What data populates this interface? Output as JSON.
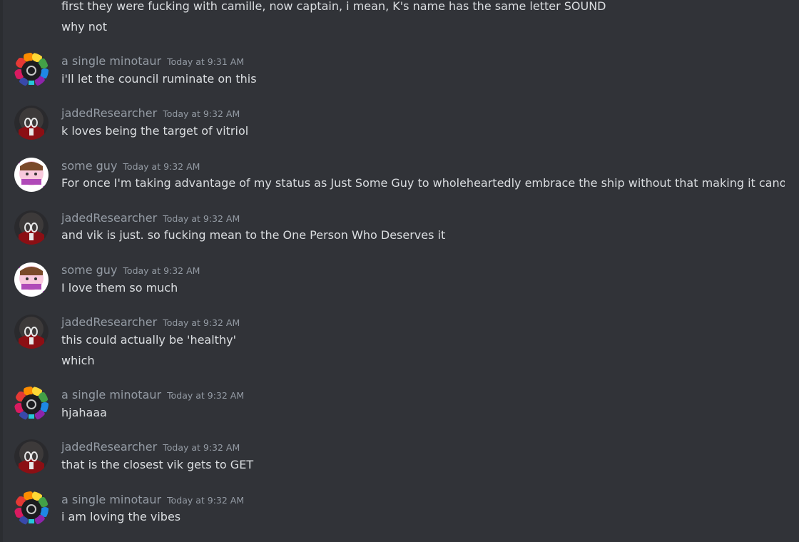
{
  "channel": {
    "messages": [
      {
        "type": "cont",
        "content": "first they were fucking with camille, now captain,  i mean, K's name has the same letter SOUND"
      },
      {
        "type": "cont",
        "content": "why not"
      },
      {
        "type": "group",
        "author": "a single minotaur",
        "avatar": "rainbow-avatar-icon",
        "timestamp": "Today at 9:31 AM",
        "content": "i'll let the council ruminate on this"
      },
      {
        "type": "group",
        "author": "jadedResearcher",
        "avatar": "dark-avatar-icon",
        "timestamp": "Today at 9:32 AM",
        "content": "k loves being the target of vitriol"
      },
      {
        "type": "group",
        "author": "some guy",
        "avatar": "pink-avatar-icon",
        "timestamp": "Today at 9:32 AM",
        "content": "For once I'm taking advantage of my status as Just Some Guy to wholeheartedly embrace the ship without that making it canon"
      },
      {
        "type": "group",
        "author": "jadedResearcher",
        "avatar": "dark-avatar-icon",
        "timestamp": "Today at 9:32 AM",
        "content": "and vik is just. so fucking mean to the One Person Who Deserves it"
      },
      {
        "type": "group",
        "author": "some guy",
        "avatar": "pink-avatar-icon",
        "timestamp": "Today at 9:32 AM",
        "content": "I love them so much"
      },
      {
        "type": "group",
        "author": "jadedResearcher",
        "avatar": "dark-avatar-icon",
        "timestamp": "Today at 9:32 AM",
        "content": "this could actually be 'healthy'"
      },
      {
        "type": "cont",
        "content": "which"
      },
      {
        "type": "group",
        "author": "a single minotaur",
        "avatar": "rainbow-avatar-icon",
        "timestamp": "Today at 9:32 AM",
        "content": "hjahaaa"
      },
      {
        "type": "group",
        "author": "jadedResearcher",
        "avatar": "dark-avatar-icon",
        "timestamp": "Today at 9:32 AM",
        "content": "that is the closest vik gets to GET"
      },
      {
        "type": "group",
        "author": "a single minotaur",
        "avatar": "rainbow-avatar-icon",
        "timestamp": "Today at 9:32 AM",
        "content": "i am loving the vibes"
      }
    ]
  },
  "colors": {
    "background": "#313338",
    "text": "#dbdee1",
    "muted": "#949ba4"
  }
}
